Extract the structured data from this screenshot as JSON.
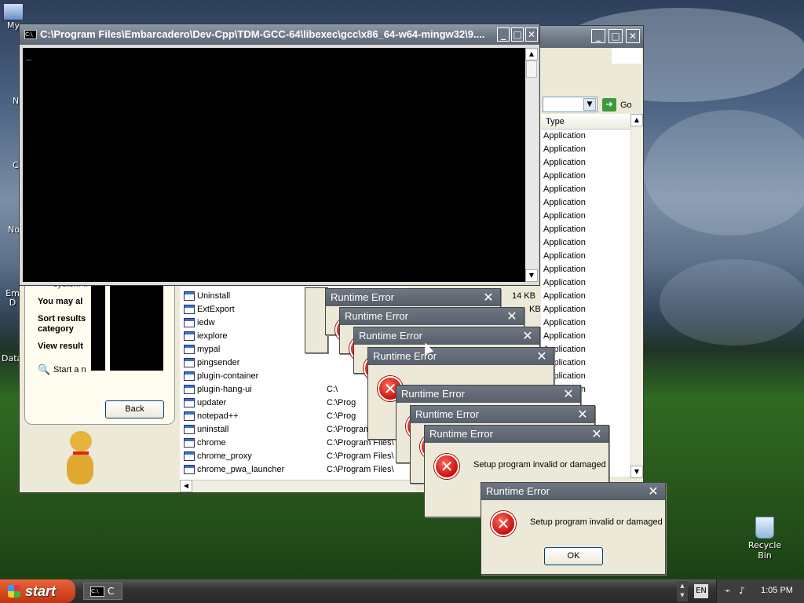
{
  "console": {
    "title": "C:\\Program Files\\Embarcadero\\Dev-Cpp\\TDM-GCC-64\\libexec\\gcc\\x86_64-w64-mingw32\\9....",
    "cursor": "_"
  },
  "explorer": {
    "go_label": "Go",
    "type_header": "Type",
    "type_values": [
      "Application",
      "Application",
      "Application",
      "Application",
      "Application",
      "Application",
      "Application",
      "Application",
      "Application",
      "Application",
      "Application",
      "Application",
      "Application",
      "Application",
      "Application",
      "Application",
      "Application",
      "Application",
      "Application",
      "Application"
    ],
    "size_partial": [
      "14 KB",
      "KB"
    ],
    "files": [
      {
        "name": "Uninstall",
        "path": ""
      },
      {
        "name": "ExtExport",
        "path": ""
      },
      {
        "name": "iedw",
        "path": ""
      },
      {
        "name": "iexplore",
        "path": ""
      },
      {
        "name": "mypal",
        "path": ""
      },
      {
        "name": "pingsender",
        "path": ""
      },
      {
        "name": "plugin-container",
        "path": ""
      },
      {
        "name": "plugin-hang-ui",
        "path": "C:\\"
      },
      {
        "name": "updater",
        "path": "C:\\Prog"
      },
      {
        "name": "notepad++",
        "path": "C:\\Prog"
      },
      {
        "name": "uninstall",
        "path": "C:\\Program"
      },
      {
        "name": "chrome",
        "path": "C:\\Program Files\\"
      },
      {
        "name": "chrome_proxy",
        "path": "C:\\Program Files\\"
      },
      {
        "name": "chrome_pwa_launcher",
        "path": "C:\\Program Files\\"
      }
    ]
  },
  "search_pane": {
    "items": [
      "system fi",
      "You may al",
      "Sort result category",
      "View result",
      "Start a n"
    ],
    "sort_line1": "Sort results",
    "sort_line2": "category",
    "back_label": "Back"
  },
  "errors": [
    {
      "title": "Runtime Error",
      "msg": ""
    },
    {
      "title": "Runtime Error",
      "msg": ""
    },
    {
      "title": "Runtime Error",
      "msg": ""
    },
    {
      "title": "Runtime Error",
      "msg": ""
    },
    {
      "title": "Runtime Error",
      "msg": ""
    },
    {
      "title": "Runtime Error",
      "msg": ""
    },
    {
      "title": "Runtime Error",
      "msg": "Setup program invalid or damaged"
    },
    {
      "title": "Runtime Error",
      "msg": "Setup program invalid or damaged",
      "ok": "OK"
    }
  ],
  "desktop": {
    "icons": [
      "My",
      "N",
      "C",
      "No",
      "Em D",
      "Data"
    ],
    "recycle_bin": "Recycle Bin"
  },
  "taskbar": {
    "start": "start",
    "task_label": "C",
    "clock": "1:05 PM"
  },
  "colors": {
    "accent_blue": "#245edb",
    "start_green": "#3c8d2f",
    "error_red": "#c80f0f"
  }
}
